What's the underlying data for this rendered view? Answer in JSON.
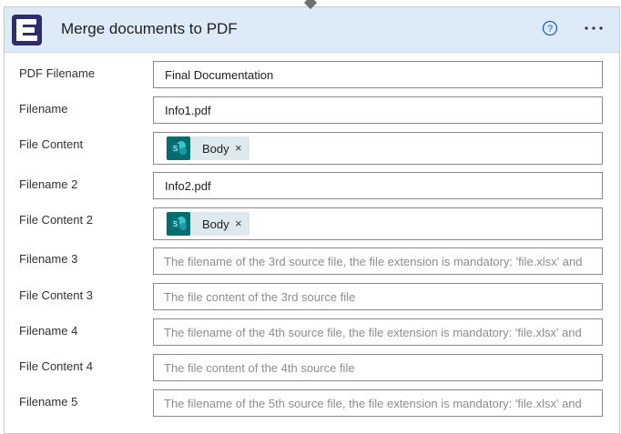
{
  "header": {
    "title": "Merge documents to PDF",
    "help_icon": "help-circle-icon",
    "more_icon": "ellipsis-icon",
    "more_label": "···"
  },
  "fields": {
    "pdf_filename": {
      "label": "PDF Filename",
      "value": "Final Documentation"
    },
    "filename": {
      "label": "Filename",
      "value": "Info1.pdf"
    },
    "file_content": {
      "label": "File Content",
      "token": {
        "label": "Body",
        "remove": "×",
        "icon": "sharepoint-icon"
      }
    },
    "filename_2": {
      "label": "Filename 2",
      "value": "Info2.pdf"
    },
    "file_content_2": {
      "label": "File Content 2",
      "token": {
        "label": "Body",
        "remove": "×",
        "icon": "sharepoint-icon"
      }
    },
    "filename_3": {
      "label": "Filename 3",
      "placeholder": "The filename of the 3rd source file, the file extension is mandatory: 'file.xlsx' and"
    },
    "file_content_3": {
      "label": "File Content 3",
      "placeholder": "The file content of the 3rd source file"
    },
    "filename_4": {
      "label": "Filename 4",
      "placeholder": "The filename of the 4th source file, the file extension is mandatory: 'file.xlsx' and"
    },
    "file_content_4": {
      "label": "File Content 4",
      "placeholder": "The file content of the 4th source file"
    },
    "filename_5": {
      "label": "Filename 5",
      "placeholder": "The filename of the 5th source file, the file extension is mandatory: 'file.xlsx' and"
    }
  },
  "colors": {
    "header_bg": "#dcebf7",
    "logo_bg": "#2e2e6e",
    "sharepoint": "#036c70",
    "token_bg": "#dde9ee",
    "help_icon": "#1e63b4"
  }
}
